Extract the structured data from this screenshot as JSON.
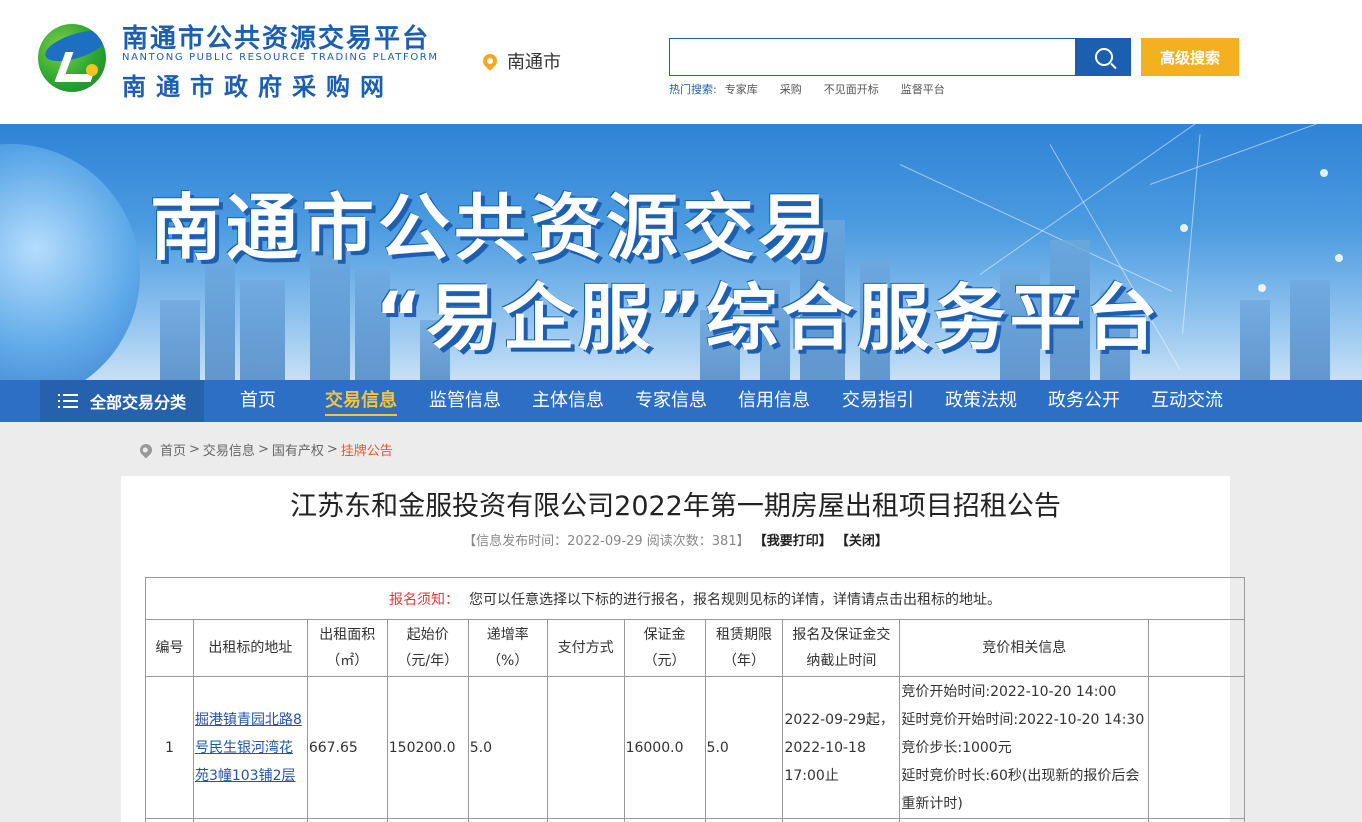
{
  "header": {
    "logo_cn": "南通市公共资源交易平台",
    "logo_en": "NANTONG PUBLIC RESOURCE TRADING PLATFORM",
    "logo_cn2": "南通市政府采购网",
    "city": "南通市",
    "search_placeholder": "",
    "advanced_search": "高级搜索",
    "hot_label": "热门搜索:",
    "hot_items": [
      "专家库",
      "采购",
      "不见面开标",
      "监督平台"
    ]
  },
  "banner": {
    "line1": "南通市公共资源交易",
    "line2": "“易企服”综合服务平台"
  },
  "nav": {
    "all_categories": "全部交易分类",
    "items": [
      "首页",
      "交易信息",
      "监管信息",
      "主体信息",
      "专家信息",
      "信用信息",
      "交易指引",
      "政策法规",
      "政务公开",
      "互动交流"
    ],
    "active": "交易信息"
  },
  "breadcrumb": {
    "items": [
      "首页",
      "交易信息",
      "国有产权"
    ],
    "current": "挂牌公告",
    "separator": ">"
  },
  "article": {
    "title": "江苏东和金服投资有限公司2022年第一期房屋出租项目招租公告",
    "meta_prefix": "【信息发布时间：2022-09-29 阅读次数：381】",
    "print": "【我要打印】",
    "close": "【关闭】"
  },
  "table": {
    "notice_label": "报名须知：",
    "notice_text": "您可以任意选择以下标的进行报名，报名规则见标的详情，详情请点击出租标的地址。",
    "headers": {
      "no": "编号",
      "address": "出租标的地址",
      "area_1": "出租面积",
      "area_2": "（㎡）",
      "price_1": "起始价",
      "price_2": "（元/年）",
      "step_1": "递增率",
      "step_2": "（%）",
      "payment": "支付方式",
      "deposit_1": "保证金",
      "deposit_2": "（元）",
      "term_1": "租赁期限",
      "term_2": "（年）",
      "deadline_1": "报名及保证金交",
      "deadline_2": "纳截止时间",
      "auction": "竞价相关信息"
    },
    "row": {
      "no": "1",
      "address": "掘港镇青园北路8号民生银河湾花苑3幢103铺2层",
      "area": "667.65",
      "price": "150200.0",
      "step": "5.0",
      "payment": "",
      "deposit": "16000.0",
      "term": "5.0",
      "deadline_1": "2022-09-29起，",
      "deadline_2": "2022-10-18",
      "deadline_3": "17:00止",
      "auction_1": "竞价开始时间:2022-10-20 14:00",
      "auction_2": "延时竞价开始时间:2022-10-20 14:30",
      "auction_3": "竞价步长:1000元",
      "auction_4": "延时竞价时长:60秒(出现新的报价后会重新计时)"
    }
  }
}
